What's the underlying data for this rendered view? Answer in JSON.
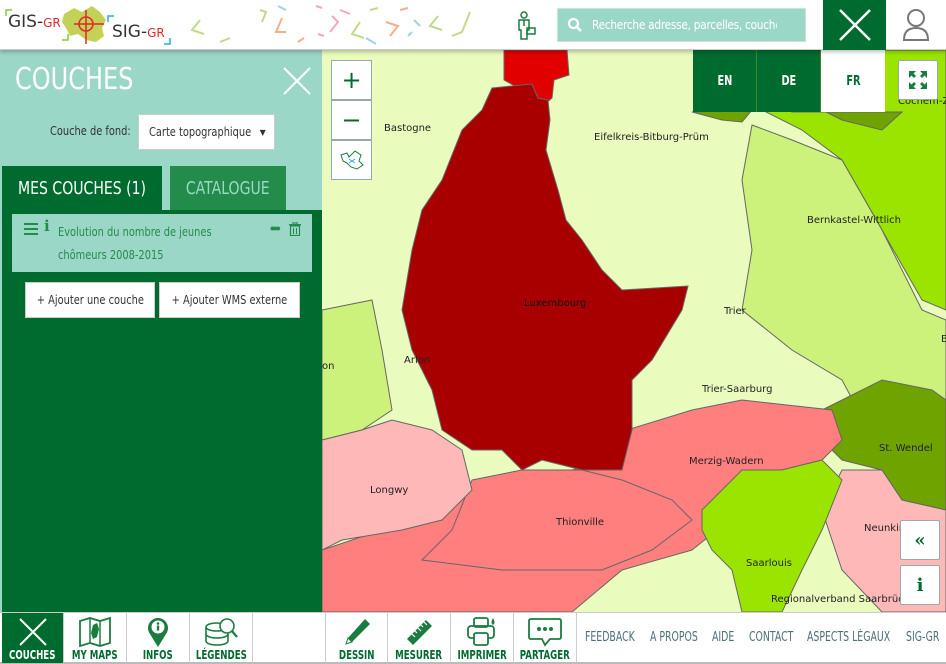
{
  "header": {
    "logo_left": "GIS-",
    "logo_left_suffix": "GR",
    "logo_right": "SIG-",
    "logo_right_suffix": "GR",
    "search_placeholder": "Recherche adresse, parcelles, couches"
  },
  "panel": {
    "title": "COUCHES",
    "background_label": "Couche de fond:",
    "background_value": "Carte topographique",
    "tabs": [
      {
        "label": "MES COUCHES (1)",
        "active": true
      },
      {
        "label": "CATALOGUE",
        "active": false
      }
    ],
    "layers": [
      {
        "title_line1": "Evolution du nombre de jeunes",
        "title_line2": "chômeurs 2008-2015"
      }
    ],
    "add_layer_label": "+ Ajouter une couche",
    "add_wms_label": "+ Ajouter WMS externe"
  },
  "map": {
    "zoom_in": "+",
    "zoom_out": "−",
    "languages": [
      {
        "code": "EN",
        "active": false
      },
      {
        "code": "DE",
        "active": false
      },
      {
        "code": "FR",
        "active": true
      }
    ],
    "collapse_label": "«",
    "info_label": "i",
    "labels": {
      "bastogne": "Bastogne",
      "eifel": "Eifelkreis-Bitburg-Prüm",
      "cochem": "Cochem-Z",
      "bernkastel": "Bernkastel-Wittlich",
      "luxembourg": "Luxembourg",
      "trier": "Trier",
      "arlon": "Arlon",
      "on": "on",
      "trier_saarburg": "Trier-Saarburg",
      "b": "B",
      "st_wendel": "St. Wendel",
      "merzig": "Merzig-Wadern",
      "longwy": "Longwy",
      "thionville": "Thionville",
      "neunkirchen": "Neunkir",
      "saarlouis": "Saarlouis",
      "saarbruecken": "Regionalverband Saarbrüc"
    },
    "colors": {
      "very_high": "#a80000",
      "high": "#e00000",
      "mid_high": "#ff7f7f",
      "low_high": "#ffb8b8",
      "neutral": "#e9fbbd",
      "low": "#cdf27b",
      "lower": "#9ae400",
      "lowest": "#6ea300"
    }
  },
  "footer": {
    "tools": [
      {
        "label": "COUCHES",
        "active": true
      },
      {
        "label": "MY MAPS",
        "active": false
      },
      {
        "label": "INFOS",
        "active": false
      },
      {
        "label": "LÉGENDES",
        "active": false
      },
      {
        "label": "DESSIN",
        "active": false
      },
      {
        "label": "MESURER",
        "active": false
      },
      {
        "label": "IMPRIMER",
        "active": false
      },
      {
        "label": "PARTAGER",
        "active": false
      }
    ],
    "links": [
      "FEEDBACK",
      "A PROPOS",
      "AIDE",
      "CONTACT",
      "ASPECTS LÉGAUX",
      "SIG-GR"
    ]
  }
}
